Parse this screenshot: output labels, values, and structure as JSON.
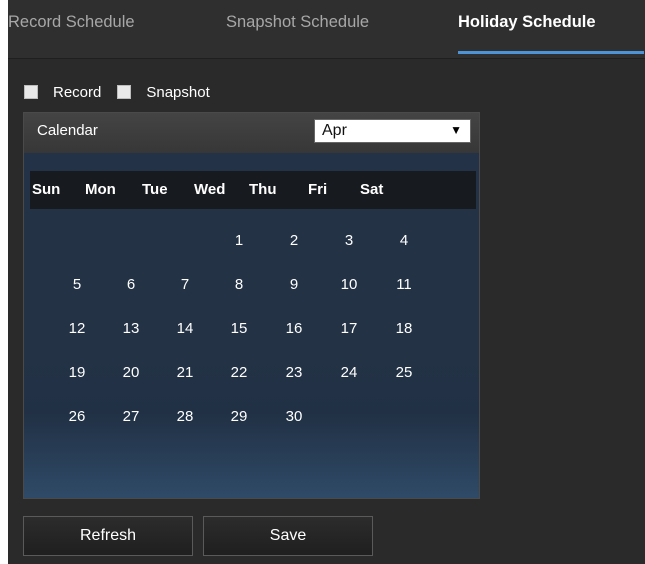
{
  "tabs": [
    {
      "label": "Record Schedule"
    },
    {
      "label": "Snapshot Schedule"
    },
    {
      "label": "Holiday Schedule",
      "active": true
    }
  ],
  "checkboxes": {
    "record_label": "Record",
    "snapshot_label": "Snapshot"
  },
  "calendar": {
    "title": "Calendar",
    "selected_month": "Apr",
    "weekdays": [
      "Sun",
      "Mon",
      "Tue",
      "Wed",
      "Thu",
      "Fri",
      "Sat"
    ],
    "dates": [
      [
        "",
        "",
        "",
        "1",
        "2",
        "3",
        "4"
      ],
      [
        "5",
        "6",
        "7",
        "8",
        "9",
        "10",
        "11"
      ],
      [
        "12",
        "13",
        "14",
        "15",
        "16",
        "17",
        "18"
      ],
      [
        "19",
        "20",
        "21",
        "22",
        "23",
        "24",
        "25"
      ],
      [
        "26",
        "27",
        "28",
        "29",
        "30",
        "",
        ""
      ]
    ]
  },
  "buttons": {
    "refresh": "Refresh",
    "save": "Save"
  },
  "colors": {
    "background": "#2a2a2a",
    "active_tab_text": "#ffffff",
    "inactive_tab_text": "#a7a7a7",
    "tab_underline": "#4c93d8",
    "calendar_gradient_bottom": "#4678aa"
  }
}
